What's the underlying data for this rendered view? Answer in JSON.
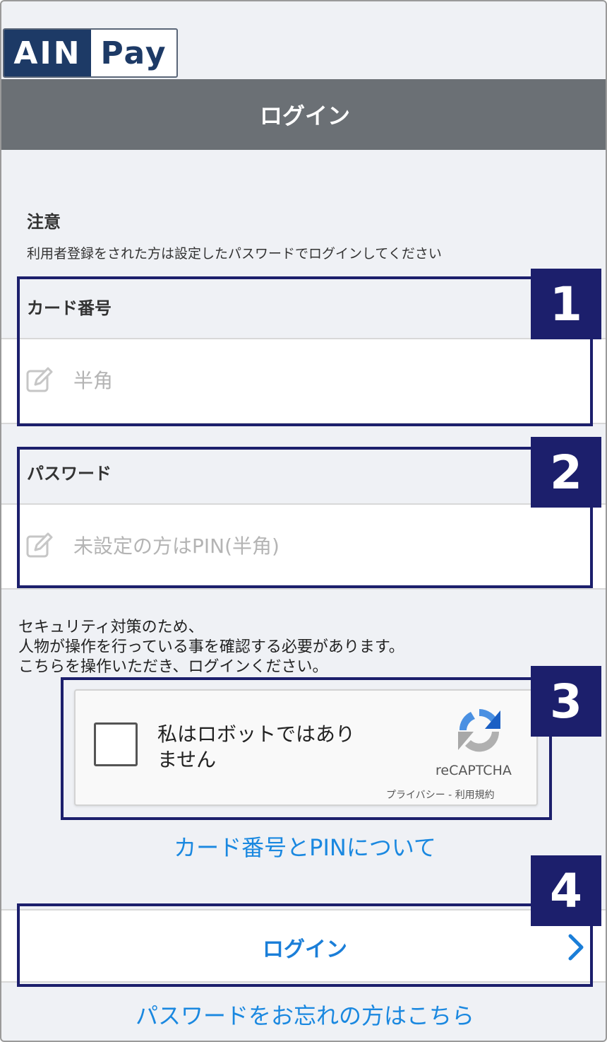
{
  "logo": {
    "left_text": "AIN",
    "right_text": "Pay"
  },
  "header": {
    "title": "ログイン"
  },
  "notice": {
    "title": "注意",
    "text": "利用者登録をされた方は設定したパスワードでログインしてください"
  },
  "card_field": {
    "label": "カード番号",
    "placeholder": "半角",
    "value": ""
  },
  "password_field": {
    "label": "パスワード",
    "placeholder": "未設定の方はPIN(半角)",
    "value": ""
  },
  "security": {
    "line1": "セキュリティ対策のため、",
    "line2": "人物が操作を行っている事を確認する必要があります。",
    "line3": "こちらを操作いただき、ログインください。"
  },
  "recaptcha": {
    "label_line1": "私はロボットではあり",
    "label_line2": "ません",
    "brand": "reCAPTCHA",
    "privacy": "プライバシー",
    "separator": " - ",
    "terms": "利用規約"
  },
  "card_pin_link": "カード番号とPINについて",
  "login_button": {
    "label": "ログイン"
  },
  "forgot_link": "パスワードをお忘れの方はこちら",
  "annotations": {
    "n1": "1",
    "n2": "2",
    "n3": "3",
    "n4": "4"
  },
  "colors": {
    "brand_navy": "#1d3a66",
    "header_gray": "#6b7075",
    "link_blue": "#1a88e0",
    "annotation_navy": "#1c1f6c"
  }
}
